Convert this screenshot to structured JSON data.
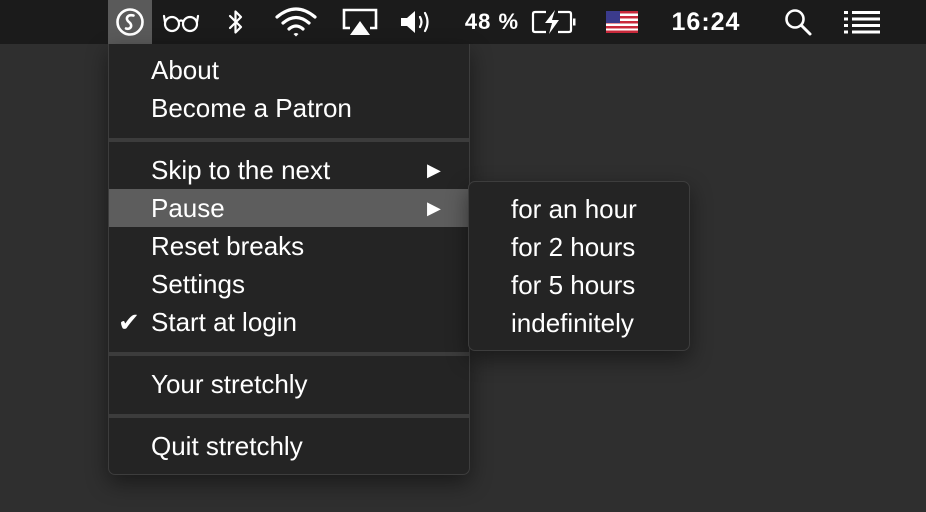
{
  "menubar": {
    "icons": [
      "stretchly-app-icon",
      "glasses-icon",
      "bluetooth-icon",
      "wifi-icon",
      "airplay-icon",
      "volume-icon",
      "battery-charging-icon",
      "us-flag-icon",
      "search-icon",
      "menu-list-icon"
    ],
    "battery_text": "48 %",
    "clock": "16:24"
  },
  "menu": {
    "items": [
      {
        "label": "About"
      },
      {
        "label": "Become a Patron"
      },
      {
        "label": "Skip to the next",
        "has_submenu": true,
        "arrow": "▶"
      },
      {
        "label": "Pause",
        "has_submenu": true,
        "highlighted": true,
        "arrow": "▶"
      },
      {
        "label": "Reset breaks"
      },
      {
        "label": "Settings"
      },
      {
        "label": "Start at login",
        "checked": true,
        "check": "✔"
      },
      {
        "label": "Your stretchly"
      },
      {
        "label": "Quit stretchly"
      }
    ]
  },
  "submenu": {
    "items": [
      {
        "label": "for an hour"
      },
      {
        "label": "for 2 hours"
      },
      {
        "label": "for 5 hours"
      },
      {
        "label": "indefinitely"
      }
    ]
  },
  "colors": {
    "menubar_bg": "#1b1b1b",
    "menu_bg": "#242424",
    "highlight": "#5d5d5d",
    "desktop": "#2f2f2f"
  }
}
